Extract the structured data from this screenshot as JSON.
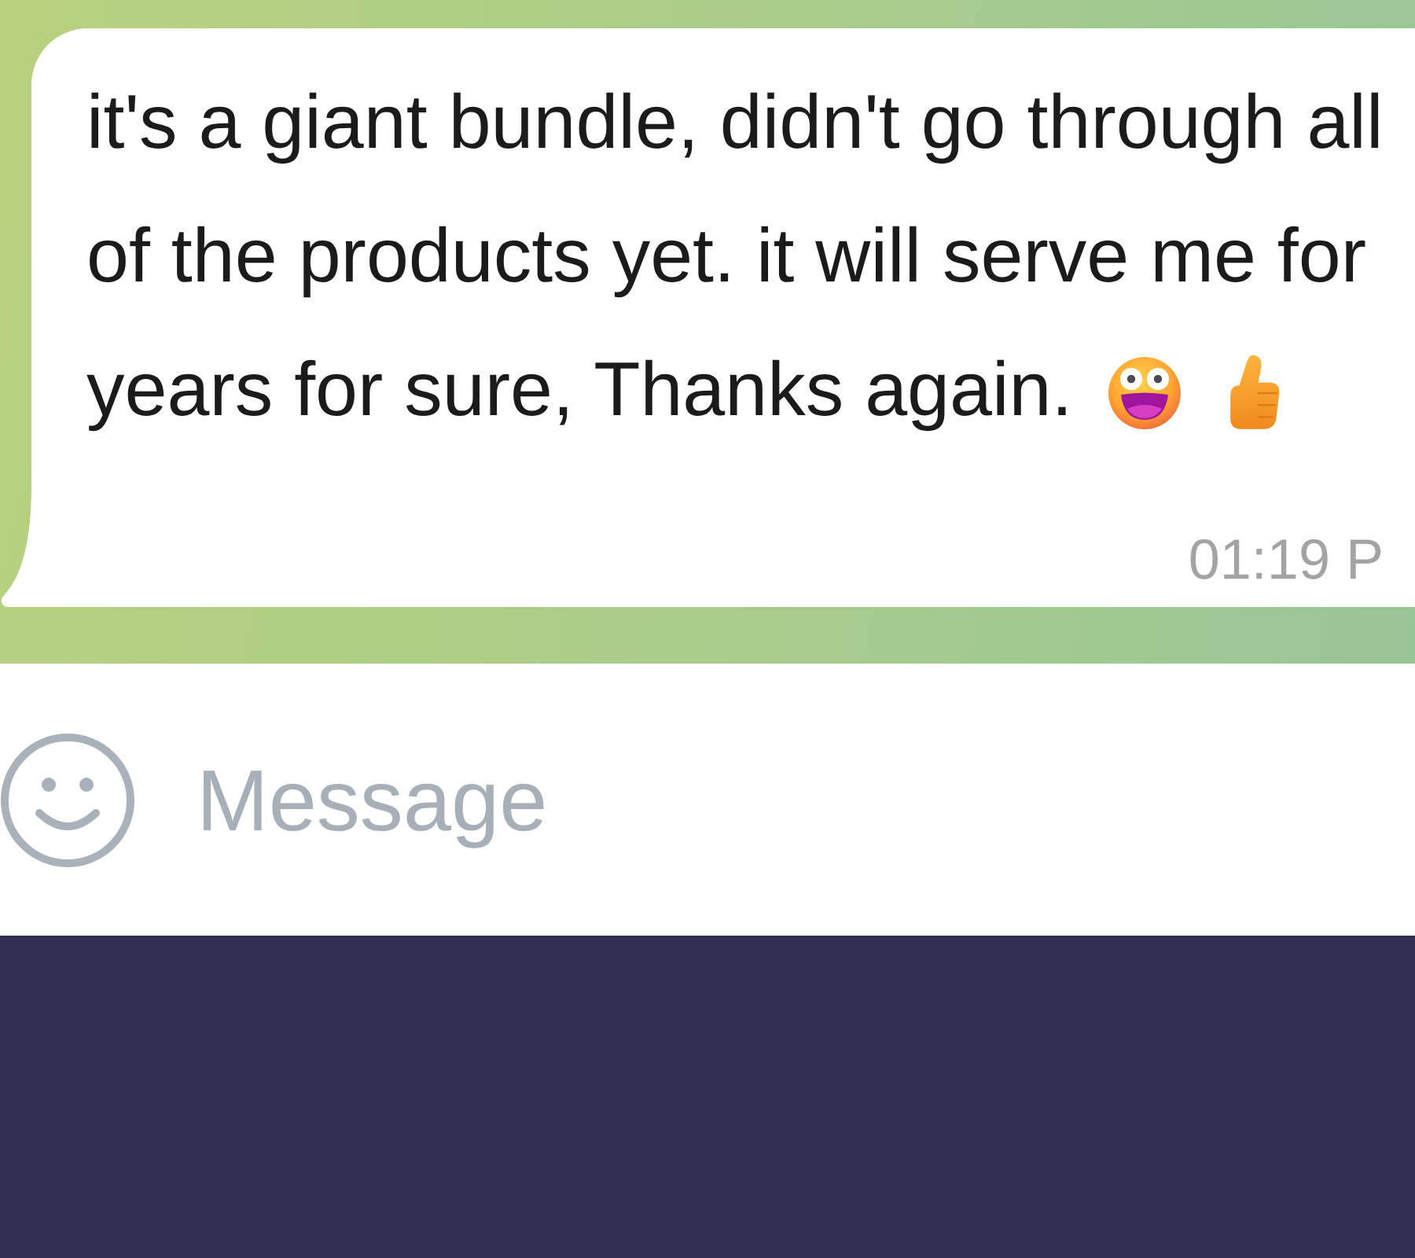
{
  "messages": [
    {
      "text": "it's a giant bundle, didn't go through all of the products yet. it will serve me for years for sure, Thanks again.",
      "time": "01:19 P"
    }
  ],
  "composer": {
    "placeholder": "Message"
  }
}
